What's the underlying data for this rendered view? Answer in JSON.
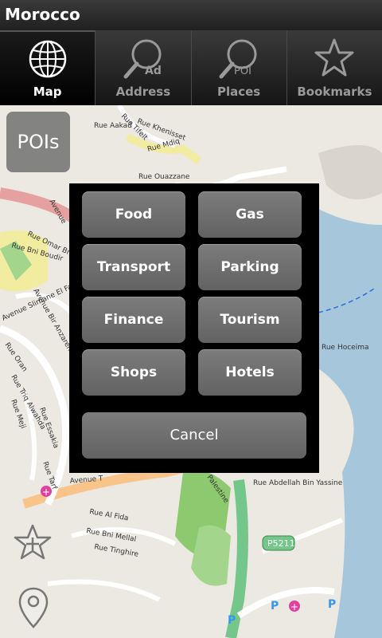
{
  "app": {
    "title": "Morocco"
  },
  "tabs": [
    {
      "label": "Map",
      "icon": "globe-icon",
      "active": true
    },
    {
      "label": "Address",
      "icon": "magnifier-ad-icon",
      "icon_text": "Ad",
      "active": false
    },
    {
      "label": "Places",
      "icon": "magnifier-poi-icon",
      "icon_text": "POI",
      "active": false
    },
    {
      "label": "Bookmarks",
      "icon": "star-icon",
      "active": false
    }
  ],
  "map": {
    "poi_button_label": "POIs",
    "streets": [
      "Rue Aakad",
      "Rue Tifelt",
      "Rue Khenisset",
      "Rue Mdiq",
      "Rue Ouazzane",
      "Rue Abdellah Bin Yassine",
      "Avenue",
      "Rue Omar Bnou Khatab",
      "Rue Bni Boudir",
      "Avenue Bir Anzaren",
      "Rue Al Fida",
      "Rue Bni Mellal",
      "Rue Tinghire",
      "Avenue Slimane El Fatwaki",
      "Rue Hoceima",
      "Palestine",
      "P5211",
      "Rue Oran",
      "Rue Triq Alwahda",
      "Rue Essakia",
      "Rue Tarf",
      "Rue Meji",
      "Avenue T"
    ]
  },
  "dialog": {
    "categories": [
      "Food",
      "Gas",
      "Transport",
      "Parking",
      "Finance",
      "Tourism",
      "Shops",
      "Hotels"
    ],
    "cancel_label": "Cancel"
  },
  "colors": {
    "water": "#a6c6dc",
    "land": "#ece8e2",
    "green": "#8cc96f",
    "road_yellow": "#f2eca0",
    "road_orange": "#f8c48a",
    "road_red": "#e6a0a0",
    "primary_green": "#74c68a"
  }
}
